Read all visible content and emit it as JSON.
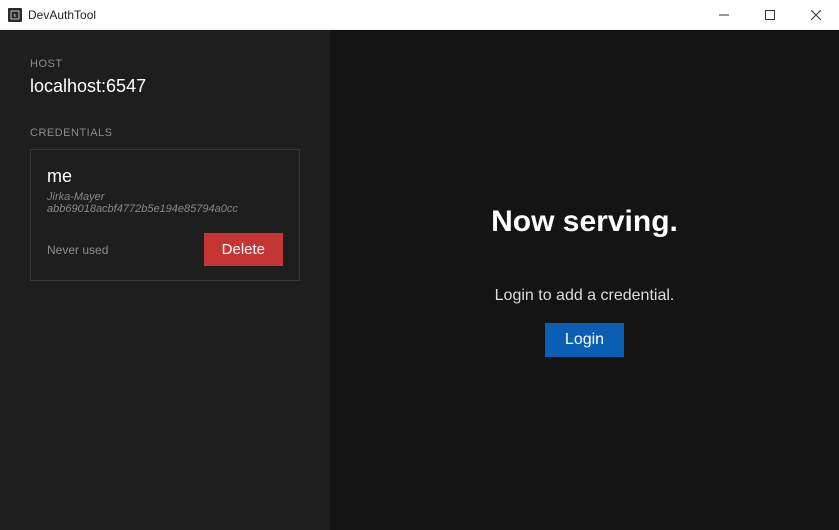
{
  "titlebar": {
    "title": "DevAuthTool"
  },
  "sidebar": {
    "host_label": "HOST",
    "host_value": "localhost:6547",
    "credentials_label": "CREDENTIALS",
    "credential": {
      "name": "me",
      "user": "Jirka-Mayer",
      "hash": "abb69018acbf4772b5e194e85794a0cc",
      "status": "Never used",
      "delete_label": "Delete"
    }
  },
  "main": {
    "heading": "Now serving.",
    "subtext": "Login to add a credential.",
    "login_label": "Login"
  }
}
